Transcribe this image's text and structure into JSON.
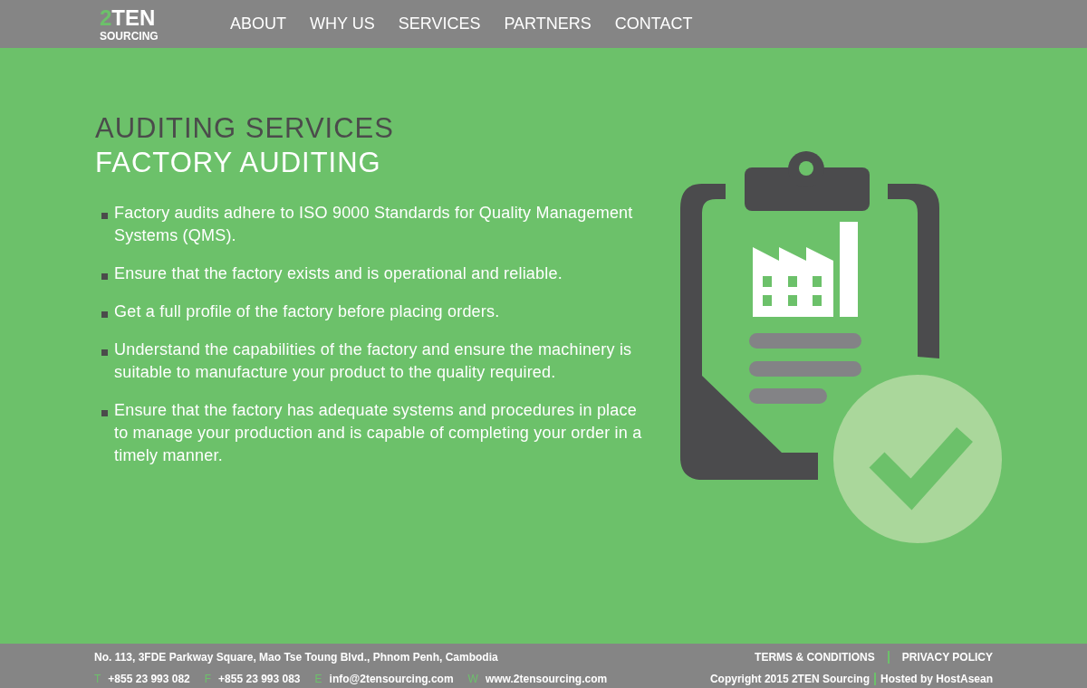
{
  "logo": {
    "mark": "2",
    "name": "TEN",
    "sub": "SOURCING"
  },
  "nav": [
    "ABOUT",
    "WHY US",
    "SERVICES",
    "PARTNERS",
    "CONTACT"
  ],
  "heading": {
    "title": "AUDITING SERVICES",
    "subtitle": "FACTORY AUDITING"
  },
  "bullets": [
    "Factory audits adhere to ISO 9000 Standards for Quality Management Systems (QMS).",
    "Ensure that the factory exists and is operational and reliable.",
    "Get a full profile of the factory before placing orders.",
    "Understand the capabilities of the factory and ensure the machinery is suitable to manufacture your product to the quality required.",
    "Ensure that the factory has adequate systems and procedures in place to manage your production and is capable of completing your order in a timely manner."
  ],
  "footer": {
    "address": "No. 113, 3FDE Parkway Square, Mao Tse Toung Blvd., Phnom Penh, Cambodia",
    "contacts": [
      {
        "label": "T",
        "value": "+855 23 993 082"
      },
      {
        "label": "F",
        "value": "+855 23 993 083"
      },
      {
        "label": "E",
        "value": "info@2tensourcing.com"
      },
      {
        "label": "W",
        "value": "www.2tensourcing.com"
      }
    ],
    "links": [
      "TERMS & CONDITIONS",
      "PRIVACY POLICY"
    ],
    "copyright": "Copyright 2015 2TEN Sourcing",
    "hosted": "Hosted by HostAsean"
  }
}
